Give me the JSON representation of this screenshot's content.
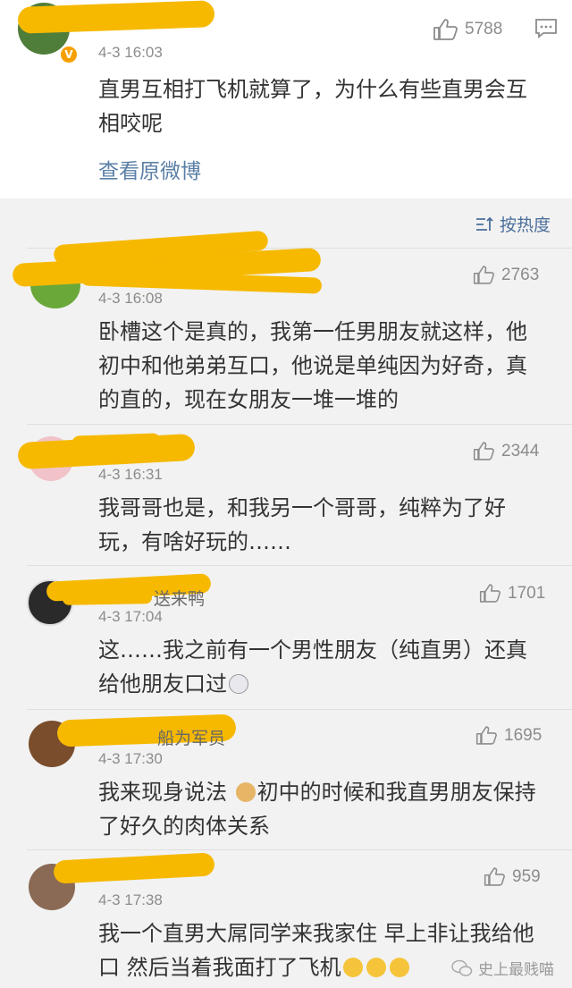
{
  "post": {
    "time": "4-3 16:03",
    "likes": "5788",
    "text": "直男互相打飞机就算了，为什么有些直男会互相咬呢",
    "view_original": "查看原微博"
  },
  "sort_label": "按热度",
  "comments": [
    {
      "time": "4-3 16:08",
      "likes": "2763",
      "text": "卧槽这个是真的，我第一任男朋友就这样，他初中和他弟弟互口，他说是单纯因为好奇，真的直的，现在女朋友一堆一堆的"
    },
    {
      "time": "4-3 16:31",
      "likes": "2344",
      "text": "我哥哥也是，和我另一个哥哥，纯粹为了好玩，有啥好玩的……"
    },
    {
      "time": "4-3 17:04",
      "likes": "1701",
      "name_partial": "送来鸭",
      "text": "这……我之前有一个男性朋友（纯直男）还真给他朋友口过"
    },
    {
      "time": "4-3 17:30",
      "likes": "1695",
      "name_partial": "船为军员",
      "text_a": "我来现身说法",
      "text_b": "初中的时候和我直男朋友保持了好久的肉体关系"
    },
    {
      "time": "4-3 17:38",
      "likes": "959",
      "text": "我一个直男大屌同学来我家住 早上非让我给他口 然后当着我面打了飞机"
    }
  ],
  "watermark": "史上最贱喵",
  "colors": {
    "redaction": "#f6b900",
    "link": "#5b7fa6",
    "sort": "#4a6f9c"
  }
}
